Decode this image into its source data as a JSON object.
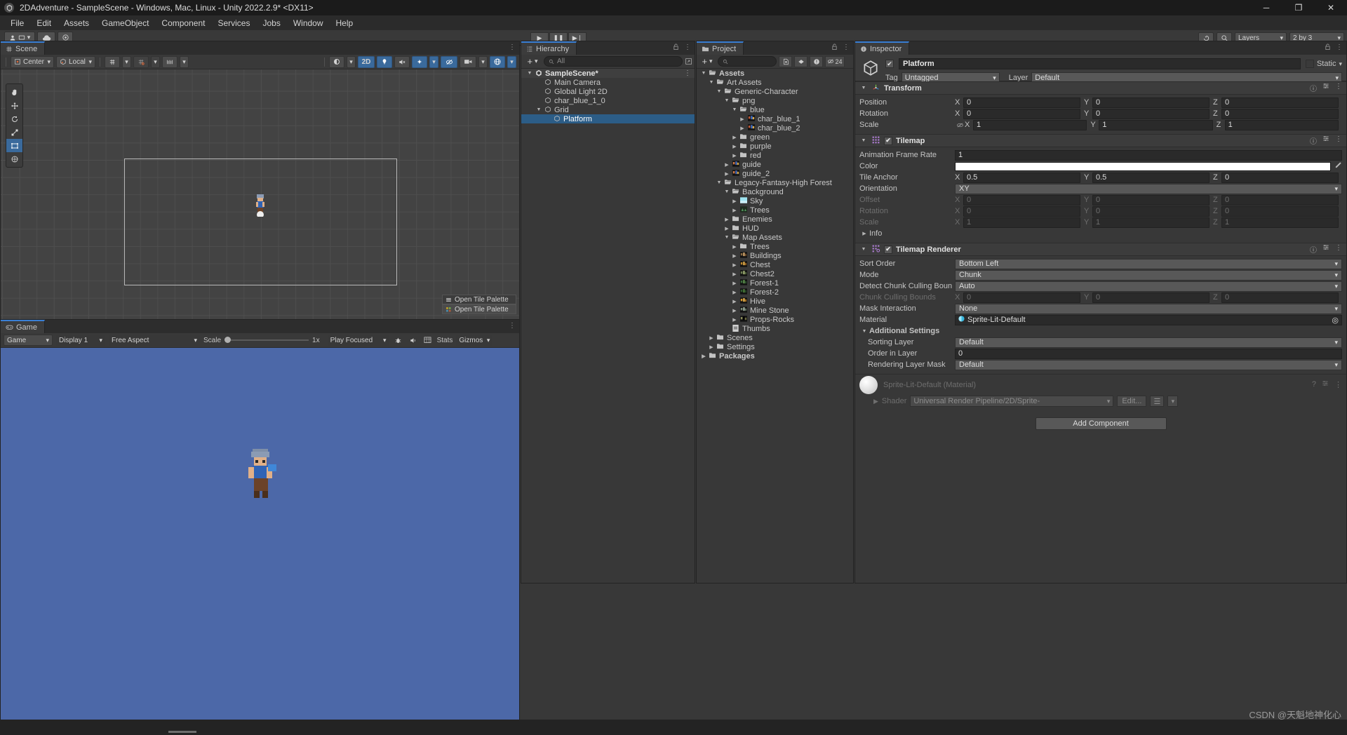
{
  "window": {
    "title": "2DAdventure - SampleScene - Windows, Mac, Linux - Unity 2022.2.9* <DX11>",
    "logo_icon": "unity-logo-icon",
    "minimize": "─",
    "maximize": "❐",
    "close": "✕"
  },
  "menu": [
    "File",
    "Edit",
    "Assets",
    "GameObject",
    "Component",
    "Services",
    "Jobs",
    "Window",
    "Help"
  ],
  "main_toolbar": {
    "account_icon": "account-icon",
    "account_caret": "▾",
    "cloud_icon": "cloud-icon",
    "collab_icon": "collab-icon"
  },
  "playbar": {
    "play_icon": "▶",
    "pause_icon": "❚❚",
    "step_icon": "▶❘",
    "undo_history_icon": "undo-history-icon",
    "search_icon": "⌕",
    "layers_label": "Layers",
    "layout_label": "2 by 3",
    "caret": "▾"
  },
  "scene": {
    "tab": "Scene",
    "tab_icon": "scene-grid-icon",
    "menu_icon": "⋮",
    "toolbar": {
      "pivot_label": "Center",
      "pivot_icon": "pivot-center-icon",
      "handle_label": "Local",
      "handle_icon": "handle-local-icon",
      "grid_icon": "grid-axis-icon",
      "snap_icon": "grid-snap-icon",
      "ruler_icon": "ruler-icon",
      "caret": "▾",
      "shading_icon": "shading-mode-icon",
      "btn_2d": "2D",
      "light_icon": "light-bulb-icon",
      "audio_icon": "audio-mute-icon",
      "fx_icon": "effects-icon",
      "hidden_icon": "hidden-objects-icon",
      "camera_icon": "scene-camera-icon",
      "gizmo_icon": "gizmo-icon"
    },
    "tools": [
      {
        "name": "hand-tool",
        "glyph": "✋",
        "active": false
      },
      {
        "name": "move-tool",
        "glyph": "✥",
        "active": false
      },
      {
        "name": "rotate-tool",
        "glyph": "↻",
        "active": false
      },
      {
        "name": "scale-tool",
        "glyph": "⛶",
        "active": false
      },
      {
        "name": "rect-tool",
        "glyph": "⬚",
        "active": true
      },
      {
        "name": "transform-tool",
        "glyph": "✹",
        "active": false
      }
    ],
    "tile_palette": {
      "row1": "Open Tile Palette",
      "row2": "Open Tile Palette",
      "row1_icon": "tile-palette-lines-icon",
      "row2_icon": "tile-palette-grid-icon"
    }
  },
  "game": {
    "tab": "Game",
    "tab_icon": "game-controller-icon",
    "menu_icon": "⋮",
    "toolbar": {
      "display_selector": "Game",
      "display": "Display 1",
      "aspect": "Free Aspect",
      "scale_label": "Scale",
      "scale_value": "1x",
      "play_focused": "Play Focused",
      "gizmos_label": "Gizmos",
      "stats_label": "Stats",
      "stats_icon": "stats-icon",
      "mute_icon": "audio-icon",
      "bug_icon": "bug-icon",
      "caret": "▾"
    },
    "background_color": "#4c68a8"
  },
  "hierarchy": {
    "tab": "Hierarchy",
    "tab_icon": "hierarchy-icon",
    "lock_icon": "lock-icon",
    "menu_icon": "⋮",
    "add_label": "+",
    "caret": "▾",
    "search_placeholder": "All",
    "search_icon": "⌕",
    "scene_menu_icon": "⋮",
    "items": [
      {
        "label": "SampleScene*",
        "depth": 0,
        "arrow": "▼",
        "icon": "unity-scene-icon",
        "selected": false,
        "header": true
      },
      {
        "label": "Main Camera",
        "depth": 1,
        "arrow": "",
        "icon": "gameobject-cube-icon",
        "selected": false
      },
      {
        "label": "Global Light 2D",
        "depth": 1,
        "arrow": "",
        "icon": "gameobject-cube-icon",
        "selected": false
      },
      {
        "label": "char_blue_1_0",
        "depth": 1,
        "arrow": "",
        "icon": "gameobject-cube-icon",
        "selected": false
      },
      {
        "label": "Grid",
        "depth": 1,
        "arrow": "▼",
        "icon": "gameobject-cube-icon",
        "selected": false
      },
      {
        "label": "Platform",
        "depth": 2,
        "arrow": "",
        "icon": "gameobject-cube-icon",
        "selected": true
      }
    ]
  },
  "project": {
    "tab": "Project",
    "tab_icon": "folder-icon",
    "lock_icon": "lock-icon",
    "menu_icon": "⋮",
    "add_label": "+",
    "caret": "▾",
    "search_icon": "⌕",
    "search_placeholder": "",
    "tool_icons": [
      "favorites-icon",
      "label-icon",
      "warning-icon",
      "hidden-icon"
    ],
    "hidden_count": "24",
    "items": [
      {
        "label": "Assets",
        "depth": 0,
        "arrow": "▼",
        "icon": "folder-open-icon",
        "bold": true
      },
      {
        "label": "Art Assets",
        "depth": 1,
        "arrow": "▼",
        "icon": "folder-open-icon"
      },
      {
        "label": "Generic-Character",
        "depth": 2,
        "arrow": "▼",
        "icon": "folder-open-icon"
      },
      {
        "label": "png",
        "depth": 3,
        "arrow": "▼",
        "icon": "folder-open-icon"
      },
      {
        "label": "blue",
        "depth": 4,
        "arrow": "▼",
        "icon": "folder-open-icon"
      },
      {
        "label": "char_blue_1",
        "depth": 5,
        "arrow": "▶",
        "icon": "sprite-sheet-icon"
      },
      {
        "label": "char_blue_2",
        "depth": 5,
        "arrow": "▶",
        "icon": "sprite-sheet-icon"
      },
      {
        "label": "green",
        "depth": 4,
        "arrow": "▶",
        "icon": "folder-icon"
      },
      {
        "label": "purple",
        "depth": 4,
        "arrow": "▶",
        "icon": "folder-icon"
      },
      {
        "label": "red",
        "depth": 4,
        "arrow": "▶",
        "icon": "folder-icon"
      },
      {
        "label": "guide",
        "depth": 3,
        "arrow": "▶",
        "icon": "texture-thumb-icon"
      },
      {
        "label": "guide_2",
        "depth": 3,
        "arrow": "▶",
        "icon": "texture-thumb-icon"
      },
      {
        "label": "Legacy-Fantasy-High Forest",
        "depth": 2,
        "arrow": "▼",
        "icon": "folder-open-icon"
      },
      {
        "label": "Background",
        "depth": 3,
        "arrow": "▼",
        "icon": "folder-open-icon"
      },
      {
        "label": "Sky",
        "depth": 4,
        "arrow": "▶",
        "icon": "sky-thumb-icon"
      },
      {
        "label": "Trees",
        "depth": 4,
        "arrow": "▶",
        "icon": "trees-thumb-icon"
      },
      {
        "label": "Enemies",
        "depth": 3,
        "arrow": "▶",
        "icon": "folder-icon"
      },
      {
        "label": "HUD",
        "depth": 3,
        "arrow": "▶",
        "icon": "folder-icon"
      },
      {
        "label": "Map Assets",
        "depth": 3,
        "arrow": "▼",
        "icon": "folder-open-icon"
      },
      {
        "label": "Trees",
        "depth": 4,
        "arrow": "▶",
        "icon": "folder-icon"
      },
      {
        "label": "Buildings",
        "depth": 4,
        "arrow": "▶",
        "icon": "buildings-thumb-icon"
      },
      {
        "label": "Chest",
        "depth": 4,
        "arrow": "▶",
        "icon": "chest-thumb-icon"
      },
      {
        "label": "Chest2",
        "depth": 4,
        "arrow": "▶",
        "icon": "chest2-thumb-icon"
      },
      {
        "label": "Forest-1",
        "depth": 4,
        "arrow": "▶",
        "icon": "forest1-thumb-icon"
      },
      {
        "label": "Forest-2",
        "depth": 4,
        "arrow": "▶",
        "icon": "forest2-thumb-icon"
      },
      {
        "label": "Hive",
        "depth": 4,
        "arrow": "▶",
        "icon": "hive-thumb-icon"
      },
      {
        "label": "Mine Stone",
        "depth": 4,
        "arrow": "▶",
        "icon": "minestone-thumb-icon"
      },
      {
        "label": "Props-Rocks",
        "depth": 4,
        "arrow": "▶",
        "icon": "props-thumb-icon"
      },
      {
        "label": "Thumbs",
        "depth": 3,
        "arrow": "",
        "icon": "thumbs-file-icon"
      },
      {
        "label": "Scenes",
        "depth": 1,
        "arrow": "▶",
        "icon": "folder-icon"
      },
      {
        "label": "Settings",
        "depth": 1,
        "arrow": "▶",
        "icon": "folder-icon"
      },
      {
        "label": "Packages",
        "depth": 0,
        "arrow": "▶",
        "icon": "folder-icon",
        "bold": true
      }
    ]
  },
  "inspector": {
    "tab": "Inspector",
    "tab_icon": "info-icon",
    "lock_icon": "lock-icon",
    "menu_icon": "⋮",
    "object_icon": "gameobject-cube-icon",
    "object_name": "Platform",
    "enabled": true,
    "check_glyph": "✔",
    "static_label": "Static",
    "static_caret": "▾",
    "tag_label": "Tag",
    "tag_value": "Untagged",
    "layer_label": "Layer",
    "layer_value": "Default",
    "caret": "▾",
    "help_icon": "?",
    "preset_icon": "preset-icon",
    "menu_dots": "⋮",
    "components": [
      {
        "name": "Transform",
        "icon": "transform-axis-icon",
        "expanded": true,
        "has_checkbox": false,
        "rows": [
          {
            "label": "Position",
            "type": "vec3",
            "x": "0",
            "y": "0",
            "z": "0",
            "dim": false
          },
          {
            "label": "Rotation",
            "type": "vec3",
            "x": "0",
            "y": "0",
            "z": "0",
            "dim": false
          },
          {
            "label": "Scale",
            "type": "vec3",
            "x": "1",
            "y": "1",
            "z": "1",
            "dim": false,
            "link_icon": "constrain-proportions-icon"
          }
        ]
      },
      {
        "name": "Tilemap",
        "icon": "tilemap-icon",
        "expanded": true,
        "has_checkbox": true,
        "checked": true,
        "rows": [
          {
            "label": "Animation Frame Rate",
            "type": "text",
            "value": "1",
            "dim": false
          },
          {
            "label": "Color",
            "type": "color",
            "value": "#ffffff",
            "dim": false,
            "picker_icon": "eyedropper-icon"
          },
          {
            "label": "Tile Anchor",
            "type": "vec3",
            "x": "0.5",
            "y": "0.5",
            "z": "0",
            "dim": false
          },
          {
            "label": "Orientation",
            "type": "dropdown",
            "value": "XY",
            "dim": false
          },
          {
            "label": "Offset",
            "type": "vec3",
            "x": "0",
            "y": "0",
            "z": "0",
            "dim": true
          },
          {
            "label": "Rotation",
            "type": "vec3",
            "x": "0",
            "y": "0",
            "z": "0",
            "dim": true
          },
          {
            "label": "Scale",
            "type": "vec3",
            "x": "1",
            "y": "1",
            "z": "1",
            "dim": true
          },
          {
            "label": "Info",
            "type": "foldout",
            "arrow": "▶",
            "dim": false
          }
        ]
      },
      {
        "name": "Tilemap Renderer",
        "icon": "tilemap-renderer-icon",
        "expanded": true,
        "has_checkbox": true,
        "checked": true,
        "rows": [
          {
            "label": "Sort Order",
            "type": "dropdown",
            "value": "Bottom Left",
            "dim": false
          },
          {
            "label": "Mode",
            "type": "dropdown",
            "value": "Chunk",
            "dim": false
          },
          {
            "label": "Detect Chunk Culling Boun",
            "type": "dropdown",
            "value": "Auto",
            "dim": false
          },
          {
            "label": "Chunk Culling Bounds",
            "type": "vec3",
            "x": "0",
            "y": "0",
            "z": "0",
            "dim": true
          },
          {
            "label": "Mask Interaction",
            "type": "dropdown",
            "value": "None",
            "dim": false
          },
          {
            "label": "Material",
            "type": "object",
            "value": "Sprite-Lit-Default",
            "dim": false,
            "obj_icon": "material-sphere-icon",
            "pick_icon": "◎"
          },
          {
            "label": "Additional Settings",
            "type": "section",
            "arrow": "▼",
            "dim": false
          },
          {
            "label": "Sorting Layer",
            "type": "dropdown",
            "value": "Default",
            "dim": false,
            "indent": true
          },
          {
            "label": "Order in Layer",
            "type": "text",
            "value": "0",
            "dim": false,
            "indent": true
          },
          {
            "label": "Rendering Layer Mask",
            "type": "dropdown",
            "value": "Default",
            "dim": false,
            "indent": true
          }
        ]
      }
    ],
    "material_preview": {
      "title": "Sprite-Lit-Default (Material)",
      "shader_label": "Shader",
      "shader_value": "Universal Render Pipeline/2D/Sprite-",
      "edit_label": "Edit...",
      "caret": "▾",
      "menu_icon": "☰"
    },
    "add_component": "Add Component"
  },
  "status": {
    "watermark": "CSDN @天魁地神化心"
  }
}
